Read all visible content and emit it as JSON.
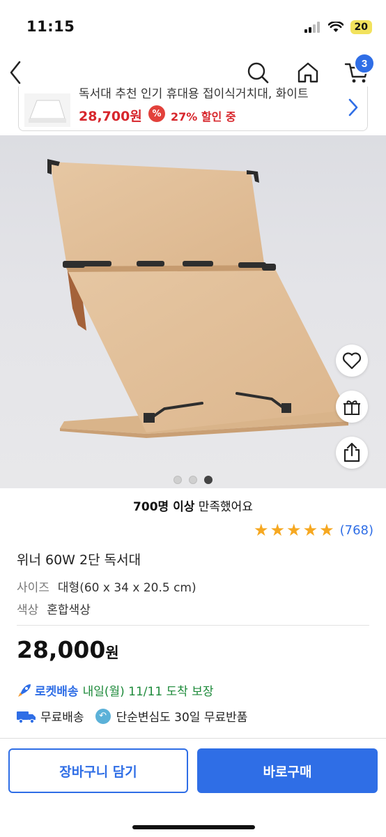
{
  "status": {
    "time": "11:15",
    "battery": "20"
  },
  "nav": {
    "cart_count": "3"
  },
  "promo": {
    "title": "독서대 추천 인기 휴대용 접이식거치대, 화이트",
    "price": "28,700원",
    "discount": "27% 할인 중",
    "discount_icon": "%"
  },
  "gallery": {
    "total": 3,
    "active_index": 2
  },
  "product": {
    "satisfaction_bold": "700명 이상",
    "satisfaction_rest": " 만족했어요",
    "rating_stars": 5,
    "review_count": "(768)",
    "title": "위너 60W 2단 독서대",
    "options": [
      {
        "label": "사이즈",
        "value": "대형(60 x 34 x 20.5 cm)"
      },
      {
        "label": "색상",
        "value": "혼합색상"
      }
    ],
    "price": "28,000",
    "price_unit": "원"
  },
  "shipping": {
    "rocket_brand": "로켓배송",
    "rocket_arrival": "내일(월) 11/11 도착 보장",
    "free_shipping": "무료배송",
    "free_return": "단순변심도 30일 무료반품"
  },
  "actions": {
    "add_to_cart": "장바구니 담기",
    "buy_now": "바로구매"
  },
  "colors": {
    "accent": "#2f6ee6",
    "sale": "#d7262c",
    "rocket_green": "#1d8a3a",
    "star": "#f6a821"
  }
}
